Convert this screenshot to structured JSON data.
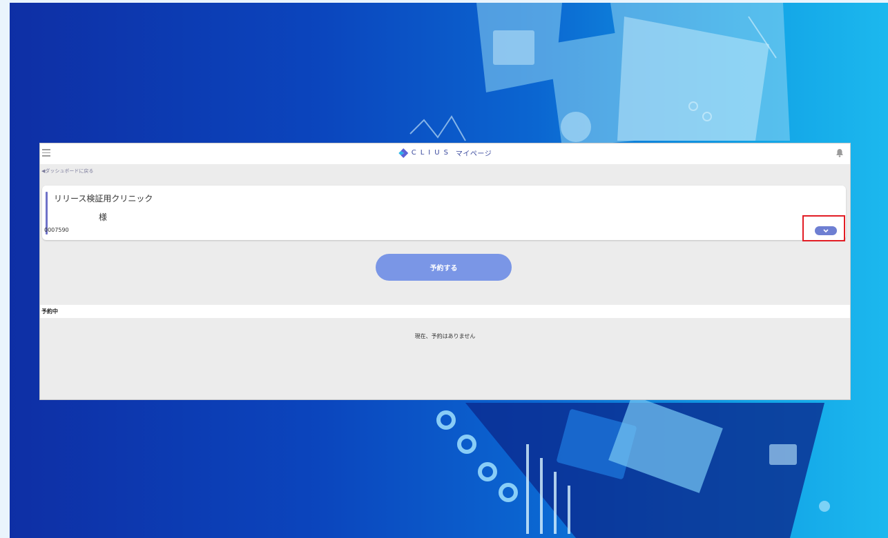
{
  "header": {
    "logo_text": "CLIUS",
    "logo_sub": "マイページ"
  },
  "nav": {
    "back_label": "◀ダッシュボードに戻る"
  },
  "patient_card": {
    "clinic_name": "リリース検証用クリニック",
    "honorific": "様",
    "patient_id": "0007590"
  },
  "actions": {
    "reserve_label": "予約する"
  },
  "reservations": {
    "section_title": "予約中",
    "empty_message": "現在、予約はありません"
  },
  "colors": {
    "accent": "#6e7fd2",
    "reserve_button": "#7a96e6",
    "highlight": "#e21c24",
    "card_bar": "#6f72c8"
  }
}
